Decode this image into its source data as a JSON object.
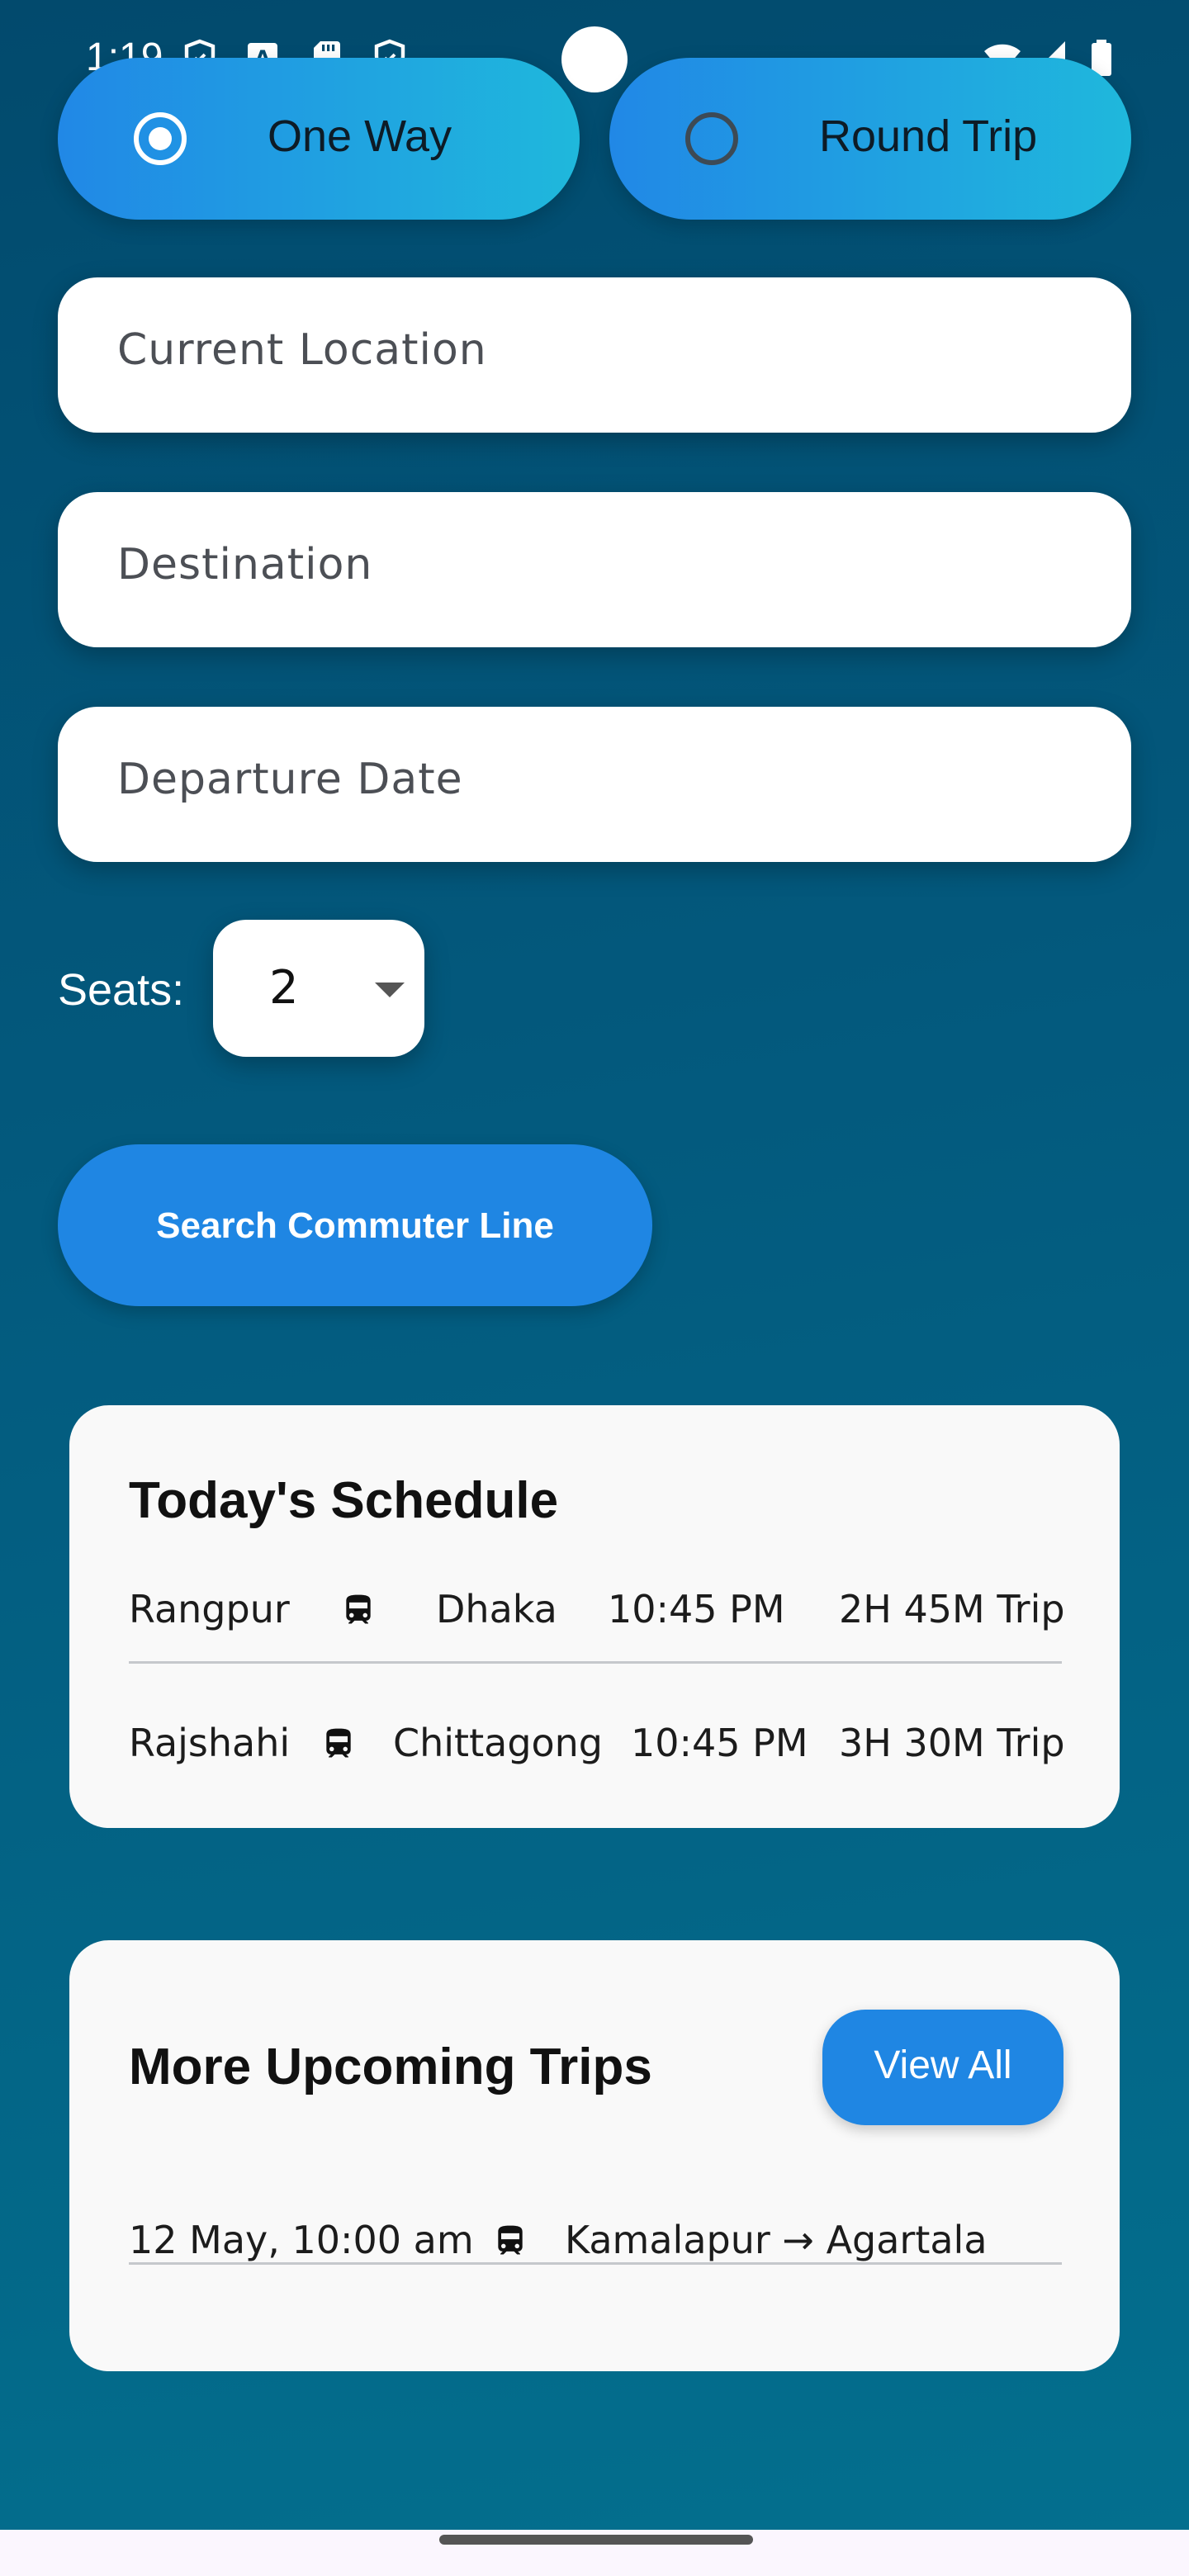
{
  "status_bar": {
    "time": "1:19",
    "left_icons": [
      "shield-icon",
      "text-a-icon",
      "sd-card-icon",
      "shield-icon"
    ],
    "right_icons": [
      "wifi-icon",
      "signal-icon",
      "battery-icon"
    ]
  },
  "trip_type": {
    "one_way_label": "One Way",
    "round_trip_label": "Round Trip",
    "selected": "One Way"
  },
  "form": {
    "current_location_placeholder": "Current Location",
    "destination_placeholder": "Destination",
    "departure_date_placeholder": "Departure Date",
    "seats_label": "Seats:",
    "seats_value": "2",
    "search_label": "Search Commuter Line"
  },
  "schedule": {
    "title": "Today's Schedule",
    "rows": [
      {
        "from": "Rangpur",
        "to": "Dhaka",
        "time": "10:45 PM",
        "duration": "2H 45M Trip"
      },
      {
        "from": "Rajshahi",
        "to": "Chittagong",
        "time": "10:45 PM",
        "duration": "3H 30M Trip"
      }
    ]
  },
  "upcoming": {
    "title": "More Upcoming Trips",
    "view_all_label": "View All",
    "rows": [
      {
        "datetime": "12 May, 10:00 am",
        "route": "Kamalapur → Agartala"
      }
    ]
  },
  "colors": {
    "background_top": "#024a6d",
    "background_bottom": "#036f8e",
    "accent": "#1f86e3",
    "toggle_gradient_end": "#1fb8dc",
    "card": "#f9f9f9"
  }
}
